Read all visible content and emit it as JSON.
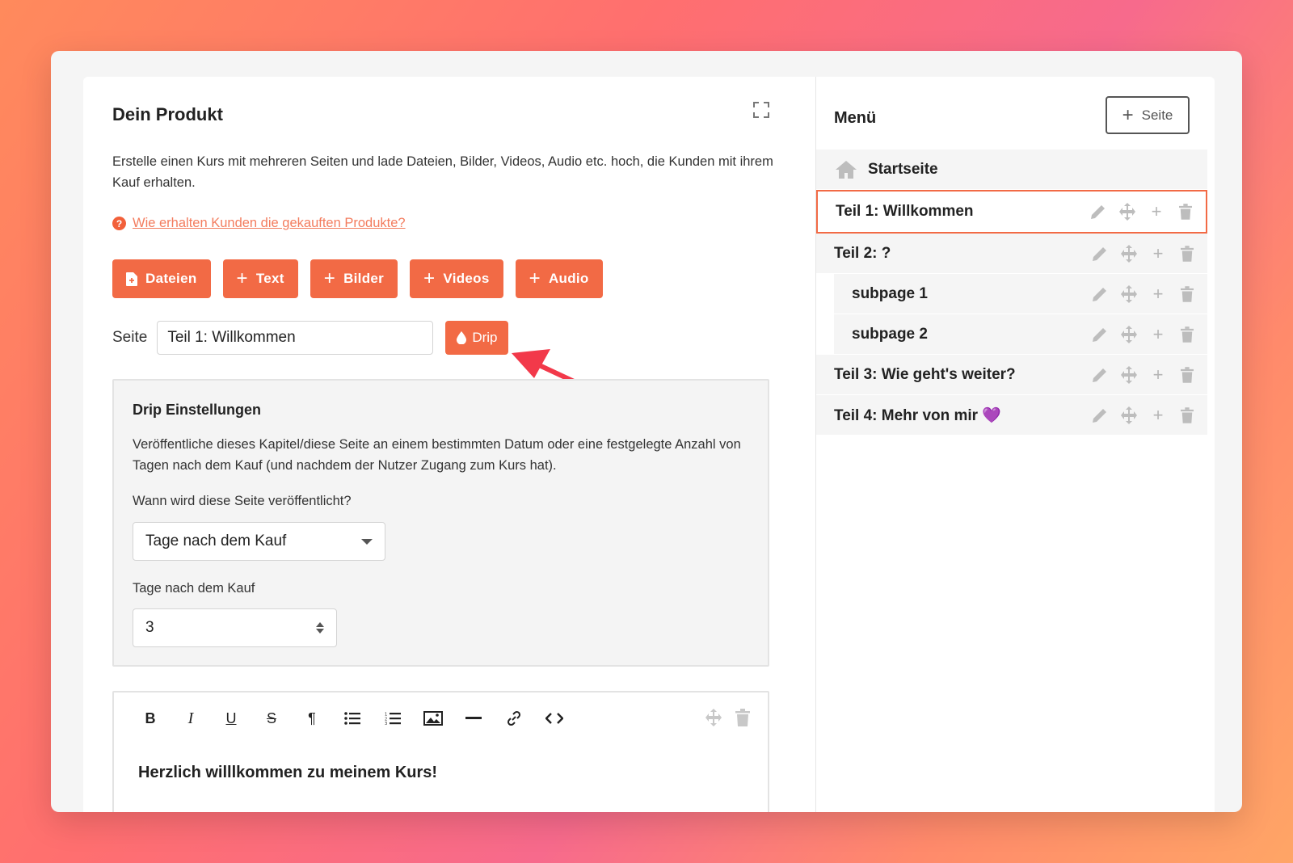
{
  "main": {
    "title": "Dein Produkt",
    "description": "Erstelle einen Kurs mit mehreren Seiten und lade Dateien, Bilder, Videos, Audio etc. hoch, die Kunden mit ihrem Kauf erhalten.",
    "help_link": "Wie erhalten Kunden die gekauften Produkte?",
    "buttons": {
      "files": "Dateien",
      "text": "Text",
      "images": "Bilder",
      "videos": "Videos",
      "audio": "Audio"
    },
    "page_label": "Seite",
    "page_value": "Teil 1: Willkommen",
    "drip_button": "Drip"
  },
  "drip": {
    "title": "Drip Einstellungen",
    "description": "Veröffentliche dieses Kapitel/diese Seite an einem bestimmten Datum oder eine festgelegte Anzahl von Tagen nach dem Kauf (und nachdem der Nutzer Zugang zum Kurs hat).",
    "when_label": "Wann wird diese Seite veröffentlicht?",
    "when_value": "Tage nach dem Kauf",
    "days_label": "Tage nach dem Kauf",
    "days_value": "3"
  },
  "editor": {
    "toolbar": [
      "bold-icon",
      "italic-icon",
      "underline-icon",
      "strikethrough-icon",
      "paragraph-icon",
      "bullet-list-icon",
      "numbered-list-icon",
      "image-icon",
      "horizontal-rule-icon",
      "link-icon",
      "code-icon"
    ],
    "heading": "Herzlich willlkommen zu meinem Kurs!"
  },
  "menu": {
    "title": "Menü",
    "add_page": "Seite",
    "home": "Startseite",
    "items": [
      {
        "label": "Teil 1: Willkommen"
      },
      {
        "label": "Teil 2: ?"
      },
      {
        "label": "subpage 1"
      },
      {
        "label": "subpage 2"
      },
      {
        "label": "Teil 3: Wie geht's weiter?"
      },
      {
        "label": "Teil 4: Mehr von mir 💜"
      }
    ]
  },
  "colors": {
    "accent": "#f26a45",
    "selected_border": "#f26a45",
    "arrow": "#f2394a"
  }
}
